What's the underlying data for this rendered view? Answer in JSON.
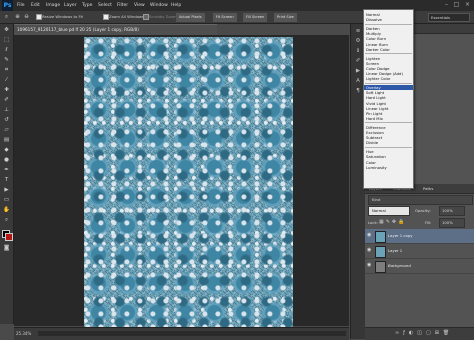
{
  "app": {
    "logo": "Ps"
  },
  "menu": [
    "File",
    "Edit",
    "Image",
    "Layer",
    "Type",
    "Select",
    "Filter",
    "View",
    "Window",
    "Help"
  ],
  "window_controls": {
    "minimize": "–",
    "maximize": "□",
    "close": "×"
  },
  "options": {
    "resize_windows_label": "Resize Windows to Fit",
    "zoom_all_label": "Zoom All Windows",
    "scrubby_zoom_label": "Scrubby Zoom",
    "actual_pixels": "Actual Pixels",
    "fit_screen": "Fit Screen",
    "fill_screen": "Fill Screen",
    "print_size": "Print Size",
    "workspace": "Essentials"
  },
  "document": {
    "tab_title": "1096157_9120117_blue pd lf 20 25 (Layer 1 copy, RGB/8)",
    "zoom": "25.34%"
  },
  "blend_modes": {
    "groups": [
      [
        "Normal",
        "Dissolve"
      ],
      [
        "Darken",
        "Multiply",
        "Color Burn",
        "Linear Burn",
        "Darker Color"
      ],
      [
        "Lighten",
        "Screen",
        "Color Dodge",
        "Linear Dodge (Add)",
        "Lighter Color"
      ],
      [
        "Overlay",
        "Soft Light",
        "Hard Light",
        "Vivid Light",
        "Linear Light",
        "Pin Light",
        "Hard Mix"
      ],
      [
        "Difference",
        "Exclusion",
        "Subtract",
        "Divide"
      ],
      [
        "Hue",
        "Saturation",
        "Color",
        "Luminosity"
      ]
    ],
    "selected": "Overlay"
  },
  "panels": {
    "top_tab": "Essentials",
    "layers_tab": "Layers",
    "channels_tab": "Channels",
    "paths_tab": "Paths"
  },
  "layers_panel": {
    "kind_label": "Kind",
    "blend_value": "Normal",
    "opacity_label": "Opacity:",
    "opacity_value": "100%",
    "lock_label": "Lock:",
    "fill_label": "Fill:",
    "fill_value": "100%",
    "layers": [
      {
        "name": "Layer 1 copy",
        "selected": true
      },
      {
        "name": "Layer 1",
        "selected": false
      },
      {
        "name": "Background",
        "selected": false
      }
    ]
  },
  "colors": {
    "accent": "#2d58a8",
    "canvas": "#6aa2b8",
    "bg": "#282828"
  }
}
